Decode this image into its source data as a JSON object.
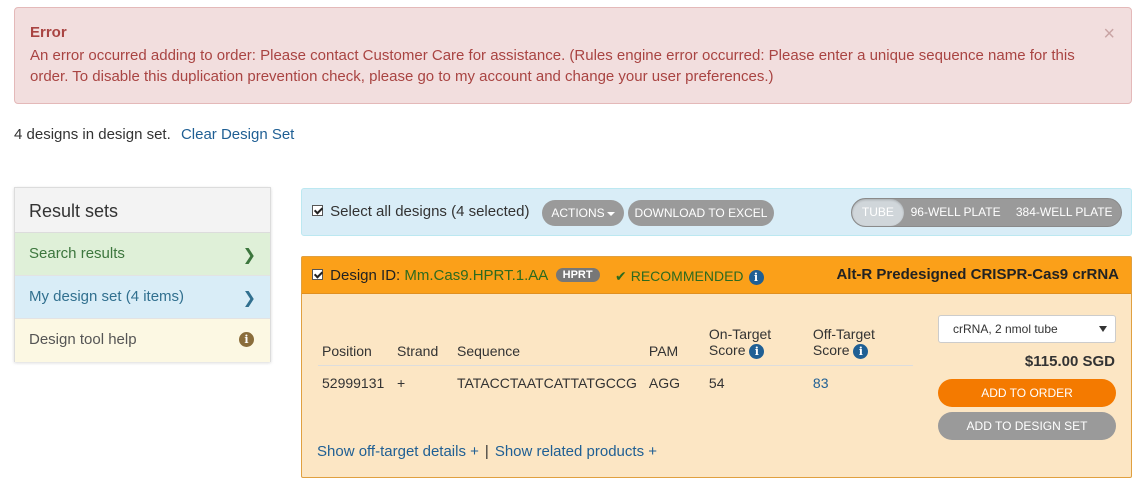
{
  "alert": {
    "title": "Error",
    "message": "An error occurred adding to order: Please contact Customer Care for assistance. (Rules engine error occurred: Please enter a unique sequence name for this order. To disable this duplication prevention check, please go to my account and change your user preferences.)",
    "close": "×"
  },
  "design_count": {
    "text": "4 designs in design set.",
    "clear_link": "Clear Design Set"
  },
  "sidebar": {
    "title": "Result sets",
    "items": [
      {
        "label": "Search results",
        "icon": "chevron-right-icon"
      },
      {
        "label": "My design set (4 items)",
        "icon": "chevron-right-icon"
      },
      {
        "label": "Design tool help",
        "icon": "info-icon"
      }
    ]
  },
  "toolbar": {
    "select_all": "Select all designs (4 selected)",
    "actions": "ACTIONS",
    "download": "DOWNLOAD TO EXCEL",
    "formats": [
      "TUBE",
      "96-WELL PLATE",
      "384-WELL PLATE"
    ],
    "selected_format": "TUBE"
  },
  "design": {
    "label": "Design ID:",
    "id": "Mm.Cas9.HPRT.1.AA",
    "gene": "HPRT",
    "recommended": "RECOMMENDED",
    "product": "Alt-R Predesigned CRISPR-Cas9 crRNA",
    "columns": [
      "Position",
      "Strand",
      "Sequence",
      "PAM",
      "On-Target",
      "Score",
      "Off-Target",
      "Score"
    ],
    "row": {
      "position": "52999131",
      "strand": "+",
      "sequence": "TATACCTAATCATTATGCCG",
      "pam": "AGG",
      "on_target": "54",
      "off_target": "83"
    },
    "quantity": "crRNA, 2 nmol tube",
    "price": "$115.00 SGD",
    "add_to_order": "ADD TO ORDER",
    "add_to_design_set": "ADD TO DESIGN SET",
    "show_off_target": "Show off-target details +",
    "separator": "|",
    "show_related": "Show related products +"
  },
  "colors": {
    "alert_bg": "#f2dede",
    "card_header": "#fba019",
    "order_button": "#f47a00",
    "link": "#1f5f94"
  }
}
